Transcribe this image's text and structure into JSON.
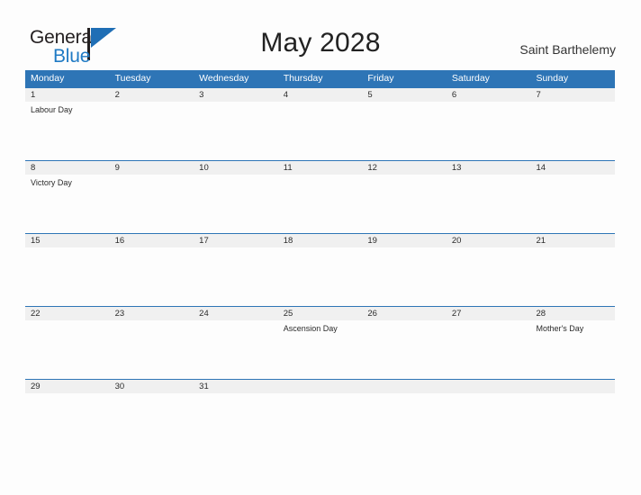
{
  "brand": {
    "name_part1": "General",
    "name_part2": "Blue",
    "flag_icon": "flag-triangle-icon",
    "accent_color": "#1f7ac4"
  },
  "header": {
    "title": "May 2028",
    "location": "Saint Barthelemy"
  },
  "theme": {
    "header_blue": "#2e75b6",
    "date_band_gray": "#f0f0f0",
    "text_dark": "#2b2b2b",
    "page_background": "#fdfdfd"
  },
  "calendar": {
    "weekdays": [
      "Monday",
      "Tuesday",
      "Wednesday",
      "Thursday",
      "Friday",
      "Saturday",
      "Sunday"
    ],
    "weeks": [
      {
        "days": [
          {
            "date": "1",
            "event": "Labour Day"
          },
          {
            "date": "2",
            "event": ""
          },
          {
            "date": "3",
            "event": ""
          },
          {
            "date": "4",
            "event": ""
          },
          {
            "date": "5",
            "event": ""
          },
          {
            "date": "6",
            "event": ""
          },
          {
            "date": "7",
            "event": ""
          }
        ]
      },
      {
        "days": [
          {
            "date": "8",
            "event": "Victory Day"
          },
          {
            "date": "9",
            "event": ""
          },
          {
            "date": "10",
            "event": ""
          },
          {
            "date": "11",
            "event": ""
          },
          {
            "date": "12",
            "event": ""
          },
          {
            "date": "13",
            "event": ""
          },
          {
            "date": "14",
            "event": ""
          }
        ]
      },
      {
        "days": [
          {
            "date": "15",
            "event": ""
          },
          {
            "date": "16",
            "event": ""
          },
          {
            "date": "17",
            "event": ""
          },
          {
            "date": "18",
            "event": ""
          },
          {
            "date": "19",
            "event": ""
          },
          {
            "date": "20",
            "event": ""
          },
          {
            "date": "21",
            "event": ""
          }
        ]
      },
      {
        "days": [
          {
            "date": "22",
            "event": ""
          },
          {
            "date": "23",
            "event": ""
          },
          {
            "date": "24",
            "event": ""
          },
          {
            "date": "25",
            "event": "Ascension Day"
          },
          {
            "date": "26",
            "event": ""
          },
          {
            "date": "27",
            "event": ""
          },
          {
            "date": "28",
            "event": "Mother's Day"
          }
        ]
      },
      {
        "days": [
          {
            "date": "29",
            "event": ""
          },
          {
            "date": "30",
            "event": ""
          },
          {
            "date": "31",
            "event": ""
          },
          {
            "date": "",
            "event": ""
          },
          {
            "date": "",
            "event": ""
          },
          {
            "date": "",
            "event": ""
          },
          {
            "date": "",
            "event": ""
          }
        ]
      }
    ]
  }
}
